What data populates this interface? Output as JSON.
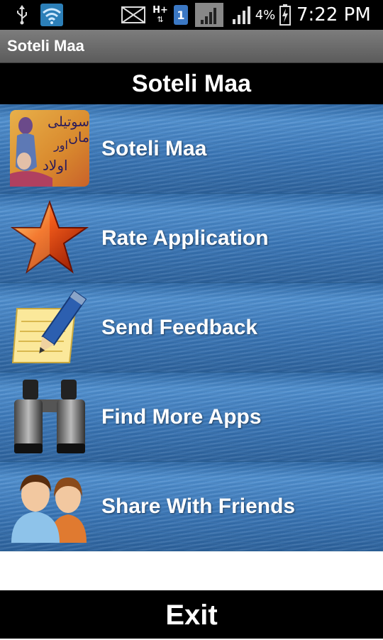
{
  "status_bar": {
    "battery_percent": "4%",
    "time": "7:22 PM",
    "sim_badge": "1",
    "network_type": "H+"
  },
  "title_bar": {
    "title": "Soteli Maa"
  },
  "header": {
    "title": "Soteli Maa"
  },
  "menu": {
    "items": [
      {
        "label": "Soteli Maa",
        "icon": "book-cover-icon",
        "cover_text": [
          "سوتیلی ماں",
          "اور",
          "اولاد"
        ]
      },
      {
        "label": "Rate Application",
        "icon": "star-icon"
      },
      {
        "label": "Send Feedback",
        "icon": "pencil-note-icon"
      },
      {
        "label": "Find More Apps",
        "icon": "binoculars-icon"
      },
      {
        "label": "Share With Friends",
        "icon": "users-icon"
      }
    ]
  },
  "footer": {
    "exit_label": "Exit"
  },
  "colors": {
    "row_blue": "#3a77b8",
    "bar_black": "#000000",
    "title_gray": "#6b6b6b"
  }
}
